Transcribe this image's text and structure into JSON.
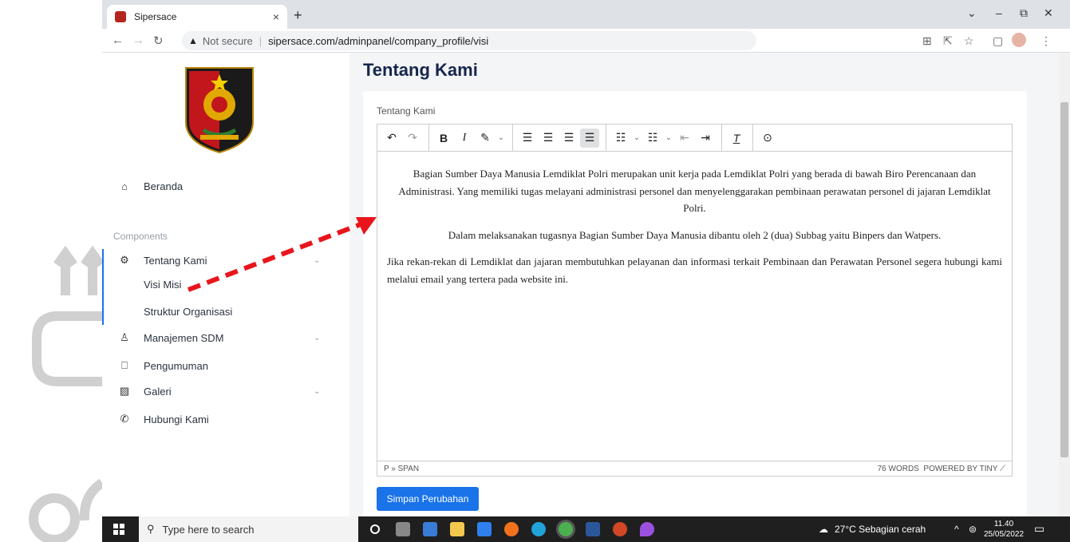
{
  "browser": {
    "tab_title": "Sipersace",
    "tab_close": "×",
    "new_tab": "+",
    "security_label": "Not secure",
    "url": "sipersace.com/adminpanel/company_profile/visi",
    "window_controls": [
      "⌄",
      "–",
      "⧉",
      "✕"
    ]
  },
  "sidebar": {
    "items_top": [
      {
        "label": "Beranda",
        "icon": "home-icon"
      }
    ],
    "section_label": "Components",
    "items": [
      {
        "label": "Tentang Kami",
        "icon": "gear-icon",
        "expandable": true
      },
      {
        "label": "Manajemen SDM",
        "icon": "person-icon",
        "expandable": true
      },
      {
        "label": "Pengumuman",
        "icon": "book-icon",
        "expandable": false
      },
      {
        "label": "Galeri",
        "icon": "image-icon",
        "expandable": true
      },
      {
        "label": "Hubungi Kami",
        "icon": "phone-icon",
        "expandable": false
      }
    ],
    "subitems": [
      {
        "label": "Visi Misi"
      },
      {
        "label": "Struktur Organisasi"
      }
    ]
  },
  "main": {
    "page_title": "Tentang Kami",
    "field_label": "Tentang Kami",
    "editor": {
      "paragraphs": [
        "Bagian Sumber Daya Manusia Lemdiklat Polri merupakan unit kerja pada Lemdiklat Polri yang berada di bawah Biro Perencanaan dan Administrasi. Yang memiliki tugas melayani administrasi personel dan menyelenggarakan pembinaan perawatan personel di jajaran Lemdiklat Polri.",
        "Dalam melaksanakan tugasnya Bagian Sumber Daya Manusia dibantu oleh 2 (dua) Subbag yaitu Binpers dan Watpers.",
        "Jika rekan-rekan di Lemdiklat dan jajaran membutuhkan pelayanan dan informasi terkait Pembinaan dan Perawatan Personel segera hubungi kami melalui email yang tertera pada website ini."
      ],
      "status_path": "P » SPAN",
      "word_count": "76 WORDS",
      "powered_by": "POWERED BY TINY"
    },
    "save_label": "Simpan Perubahan"
  },
  "taskbar": {
    "search_placeholder": "Type here to search",
    "weather": "27°C  Sebagian cerah",
    "time": "11.40",
    "date": "25/05/2022"
  },
  "colors": {
    "accent": "#1a73e8",
    "title": "#16264d",
    "annotation_arrow": "#e8161c"
  }
}
